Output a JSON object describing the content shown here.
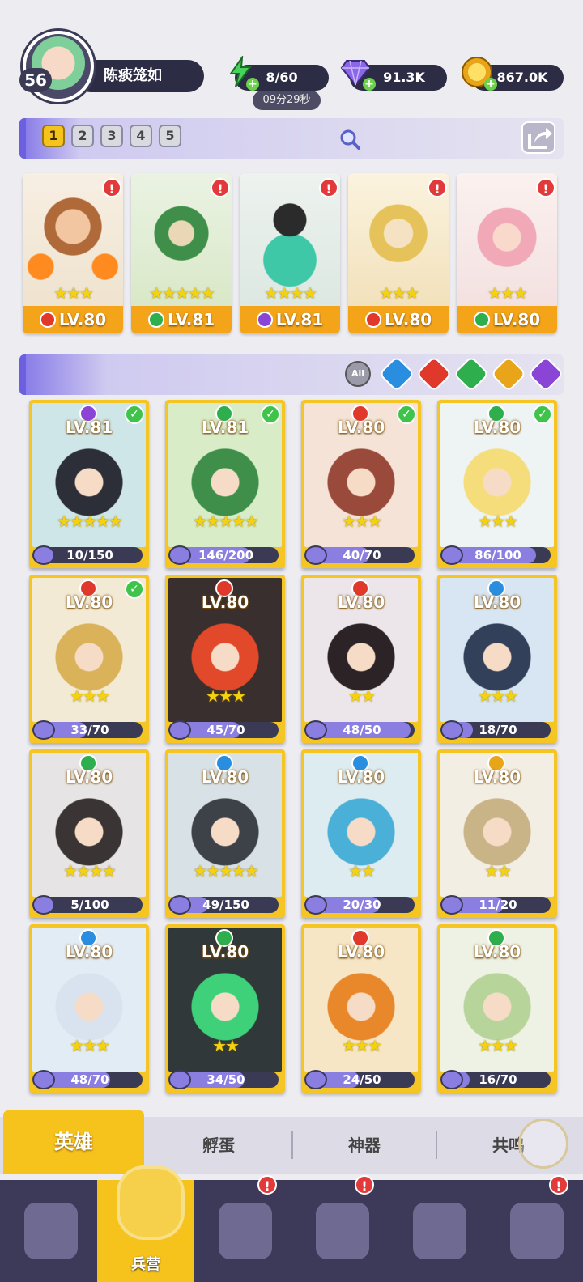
{
  "player": {
    "level": "56",
    "name": "陈痰笼如"
  },
  "resources": {
    "energy": {
      "value": "8/60",
      "timer": "09分29秒"
    },
    "gems": {
      "value": "91.3K"
    },
    "coins": {
      "value": "867.0K"
    }
  },
  "team_tabs": [
    "1",
    "2",
    "3",
    "4",
    "5"
  ],
  "team": [
    {
      "element": "fire",
      "stars": 3,
      "level": "LV.80",
      "alert": "!"
    },
    {
      "element": "wind",
      "stars": 5,
      "level": "LV.81",
      "alert": "!"
    },
    {
      "element": "dark",
      "stars": 4,
      "level": "LV.81",
      "alert": "!"
    },
    {
      "element": "fire",
      "stars": 3,
      "level": "LV.80",
      "alert": "!"
    },
    {
      "element": "wind",
      "stars": 3,
      "level": "LV.80",
      "alert": "!"
    }
  ],
  "filters": {
    "all_label": "All",
    "elements": [
      "water",
      "fire",
      "wind",
      "light",
      "dark"
    ]
  },
  "heroes": [
    {
      "element": "dark",
      "level": "LV.81",
      "stars": 5,
      "shards": "10/150",
      "progress": 0.07,
      "ready": true
    },
    {
      "element": "wind",
      "level": "LV.81",
      "stars": 5,
      "shards": "146/200",
      "progress": 0.73,
      "ready": true
    },
    {
      "element": "fire",
      "level": "LV.80",
      "stars": 3,
      "shards": "40/70",
      "progress": 0.57,
      "ready": true
    },
    {
      "element": "wind",
      "level": "LV.80",
      "stars": 3,
      "shards": "86/100",
      "progress": 0.86,
      "ready": true
    },
    {
      "element": "fire",
      "level": "LV.80",
      "stars": 3,
      "shards": "33/70",
      "progress": 0.47,
      "ready": true
    },
    {
      "element": "fire",
      "level": "LV.80",
      "stars": 3,
      "shards": "45/70",
      "progress": 0.64,
      "ready": false
    },
    {
      "element": "fire",
      "level": "LV.80",
      "stars": 2,
      "shards": "48/50",
      "progress": 0.96,
      "ready": false
    },
    {
      "element": "water",
      "level": "LV.80",
      "stars": 3,
      "shards": "18/70",
      "progress": 0.26,
      "ready": false
    },
    {
      "element": "wind",
      "level": "LV.80",
      "stars": 4,
      "shards": "5/100",
      "progress": 0.05,
      "ready": false
    },
    {
      "element": "water",
      "level": "LV.80",
      "stars": 5,
      "shards": "49/150",
      "progress": 0.33,
      "ready": false
    },
    {
      "element": "water",
      "level": "LV.80",
      "stars": 2,
      "shards": "20/30",
      "progress": 0.67,
      "ready": false
    },
    {
      "element": "light",
      "level": "LV.80",
      "stars": 2,
      "shards": "11/20",
      "progress": 0.55,
      "ready": false
    },
    {
      "element": "water",
      "level": "LV.80",
      "stars": 3,
      "shards": "48/70",
      "progress": 0.69,
      "ready": false
    },
    {
      "element": "wind",
      "level": "LV.80",
      "stars": 2,
      "shards": "34/50",
      "progress": 0.68,
      "ready": false
    },
    {
      "element": "fire",
      "level": "LV.80",
      "stars": 3,
      "shards": "24/50",
      "progress": 0.48,
      "ready": false
    },
    {
      "element": "wind",
      "level": "LV.80",
      "stars": 3,
      "shards": "16/70",
      "progress": 0.23,
      "ready": false
    }
  ],
  "sub_tabs": [
    "英雄",
    "孵蛋",
    "神器",
    "共鸣"
  ],
  "nav": [
    {
      "name": "cards",
      "label": "",
      "alert": ""
    },
    {
      "name": "barracks",
      "label": "兵营",
      "alert": ""
    },
    {
      "name": "map",
      "label": "",
      "alert": "!"
    },
    {
      "name": "castle",
      "label": "",
      "alert": "!"
    },
    {
      "name": "guild",
      "label": "",
      "alert": ""
    },
    {
      "name": "banner",
      "label": "",
      "alert": "!"
    }
  ],
  "colors": {
    "fire": "#e0392b",
    "water": "#2a8ee0",
    "wind": "#2fae4e",
    "light": "#e8a51a",
    "dark": "#8a44d6",
    "accent": "#f6c21c",
    "panel": "#2c2c44"
  }
}
